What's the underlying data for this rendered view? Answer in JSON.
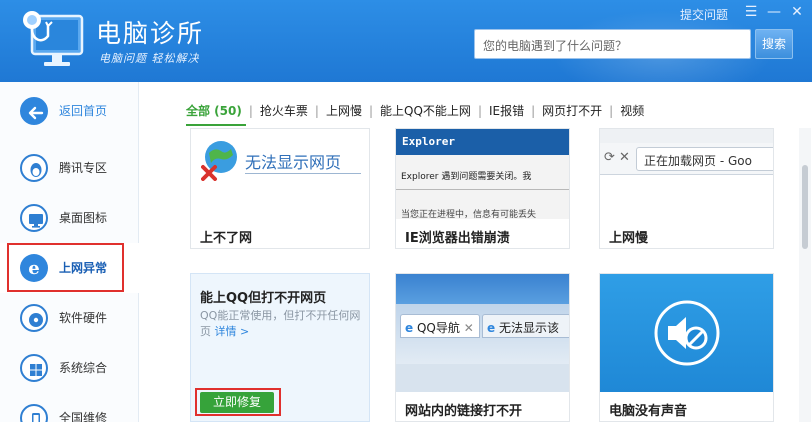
{
  "header": {
    "app_name": "电脑诊所",
    "slogan": "电脑问题 轻松解决",
    "report_link": "提交问题",
    "search_placeholder": "您的电脑遇到了什么问题？",
    "search_button": "搜索",
    "menu_glyph": "☰",
    "minimize_glyph": "—",
    "close_glyph": "✕"
  },
  "sidebar": {
    "items": [
      {
        "label": "返回首页",
        "icon": "back-arrow-icon"
      },
      {
        "label": "腾讯专区",
        "icon": "qq-penguin-icon"
      },
      {
        "label": "桌面图标",
        "icon": "monitor-icon"
      },
      {
        "label": "上网异常",
        "icon": "ie-browser-icon",
        "active": true
      },
      {
        "label": "软件硬件",
        "icon": "cd-disc-icon"
      },
      {
        "label": "系统综合",
        "icon": "windows-logo-icon"
      },
      {
        "label": "全国维修",
        "icon": "phone-icon"
      }
    ]
  },
  "tabs": [
    "全部 (50)",
    "抢火车票",
    "上网慢",
    "能上QQ不能上网",
    "IE报错",
    "网页打不开",
    "视频"
  ],
  "cards": {
    "c1": {
      "title": "上不了网",
      "thumb_text": "无法显示网页"
    },
    "c2": {
      "title": "IE浏览器出错崩溃",
      "thumb_title": "Explorer",
      "thumb_line1": "Explorer 遇到问题需要关闭。我",
      "thumb_line2": "当您正在进程中，信息有可能丢失"
    },
    "c3": {
      "title": "上网慢",
      "thumb_text": "正在加载网页 - Goo"
    },
    "c4": {
      "title": "能上QQ但打不开网页",
      "desc": "QQ能正常使用，但打不开任何网页",
      "details_link": "详情 >",
      "fix_button": "立即修复"
    },
    "c5": {
      "title": "网站内的链接打不开",
      "tab1": "QQ导航",
      "tab2": "无法显示该"
    },
    "c6": {
      "title": "电脑没有声音"
    }
  },
  "colors": {
    "header_blue": "#2383dc",
    "accent_green": "#3aa33a",
    "highlight_red": "#e0302d",
    "link_blue": "#2f86dd"
  }
}
